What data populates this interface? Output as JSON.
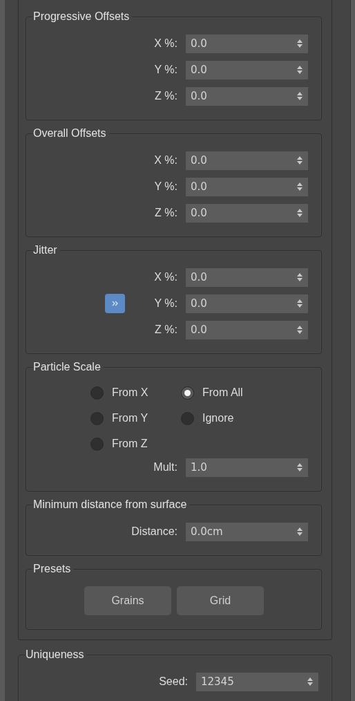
{
  "rollout": {
    "groups": [
      {
        "title": "Progressive Offsets",
        "rows": [
          {
            "kind": "spinner",
            "label": "X %:",
            "value": "0.0",
            "extra_button": false
          },
          {
            "kind": "spinner",
            "label": "Y %:",
            "value": "0.0",
            "extra_button": false
          },
          {
            "kind": "spinner",
            "label": "Z %:",
            "value": "0.0",
            "extra_button": false
          }
        ]
      },
      {
        "title": "Overall Offsets",
        "rows": [
          {
            "kind": "spinner",
            "label": "X %:",
            "value": "0.0",
            "extra_button": false
          },
          {
            "kind": "spinner",
            "label": "Y %:",
            "value": "0.0",
            "extra_button": false
          },
          {
            "kind": "spinner",
            "label": "Z %:",
            "value": "0.0",
            "extra_button": false
          }
        ]
      },
      {
        "title": "Jitter",
        "rows": [
          {
            "kind": "spinner",
            "label": "X %:",
            "value": "0.0",
            "extra_button": false
          },
          {
            "kind": "spinner",
            "label": "Y %:",
            "value": "0.0",
            "extra_button": true
          },
          {
            "kind": "spinner",
            "label": "Z %:",
            "value": "0.0",
            "extra_button": false
          }
        ]
      },
      {
        "title": "Particle Scale",
        "rows": [
          {
            "kind": "radios",
            "options": [
              {
                "label": "From X",
                "selected": false
              },
              {
                "label": "From All",
                "selected": true
              },
              {
                "label": "From Y",
                "selected": false
              },
              {
                "label": "Ignore",
                "selected": false
              },
              {
                "label": "From Z",
                "selected": false
              }
            ]
          },
          {
            "kind": "spinner",
            "label": "Mult:",
            "value": "1.0",
            "extra_button": false
          }
        ]
      },
      {
        "title": "Minimum distance from surface",
        "rows": [
          {
            "kind": "spinner",
            "label": "Distance:",
            "value": "0.0cm",
            "extra_button": false
          }
        ]
      },
      {
        "title": "Presets",
        "rows": [
          {
            "kind": "buttons",
            "buttons": [
              "Grains",
              "Grid"
            ]
          }
        ]
      }
    ]
  },
  "uniqueness": {
    "title": "Uniqueness",
    "rows": [
      {
        "kind": "spinner",
        "label": "Seed:",
        "value": "12345",
        "extra_button": false
      }
    ]
  }
}
